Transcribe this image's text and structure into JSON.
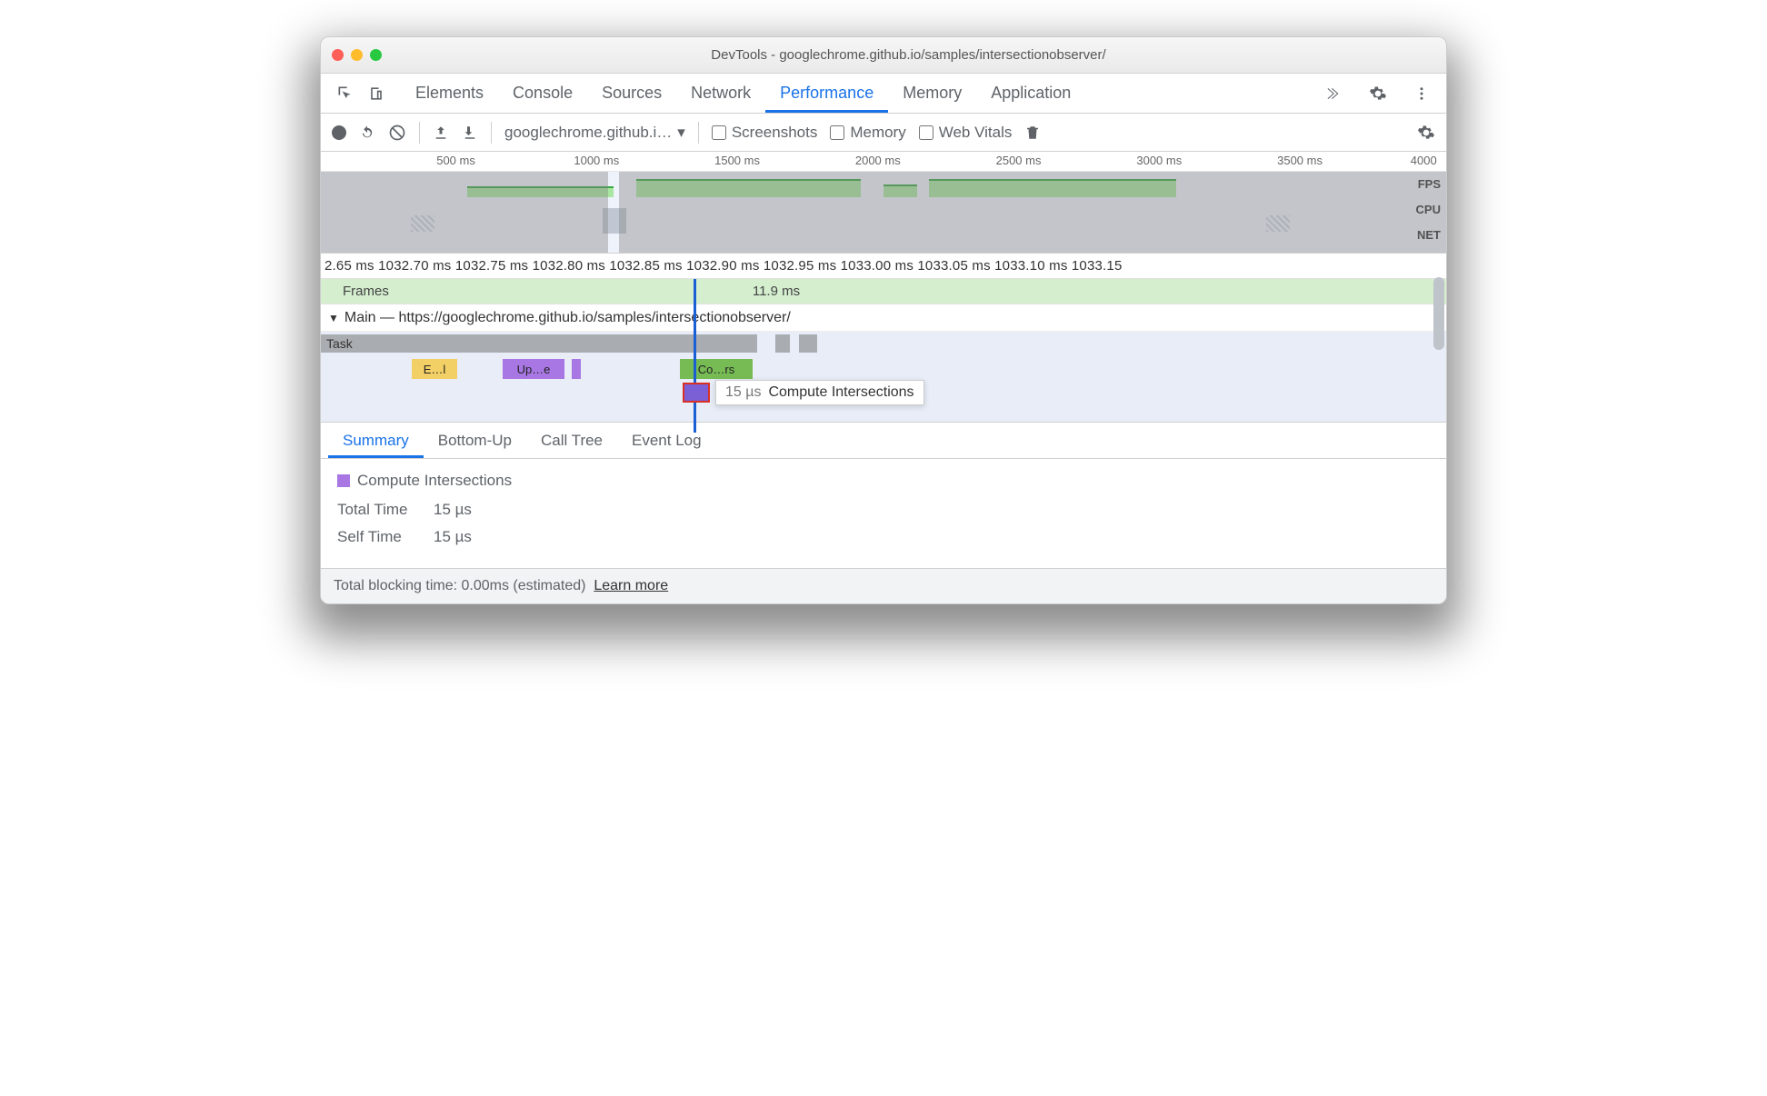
{
  "window": {
    "title": "DevTools - googlechrome.github.io/samples/intersectionobserver/"
  },
  "tabs": {
    "items": [
      "Elements",
      "Console",
      "Sources",
      "Network",
      "Performance",
      "Memory",
      "Application"
    ],
    "active": "Performance"
  },
  "toolbar": {
    "url": "googlechrome.github.i…",
    "screenshots": "Screenshots",
    "memory": "Memory",
    "webvitals": "Web Vitals"
  },
  "ruler": [
    "500 ms",
    "1000 ms",
    "1500 ms",
    "2000 ms",
    "2500 ms",
    "3000 ms",
    "3500 ms",
    "4000 ms"
  ],
  "overview_labels": [
    "FPS",
    "CPU",
    "NET"
  ],
  "zoom_ruler": "2.65 ms 1032.70 ms 1032.75 ms 1032.80 ms 1032.85 ms 1032.90 ms 1032.95 ms 1033.00 ms 1033.05 ms 1033.10 ms 1033.15",
  "frames": {
    "label": "Frames",
    "value": "11.9 ms"
  },
  "main_header": "Main — https://googlechrome.github.io/samples/intersectionobserver/",
  "flame": {
    "task": "Task",
    "yellow": "E…l",
    "purple": "Up…e",
    "green": "Co…rs",
    "tooltip_duration": "15 µs",
    "tooltip_label": "Compute Intersections"
  },
  "detail_tabs": [
    "Summary",
    "Bottom-Up",
    "Call Tree",
    "Event Log"
  ],
  "detail_active": "Summary",
  "summary": {
    "name": "Compute Intersections",
    "total_label": "Total Time",
    "total_value": "15 µs",
    "self_label": "Self Time",
    "self_value": "15 µs"
  },
  "footer": {
    "text": "Total blocking time: 0.00ms (estimated)",
    "link": "Learn more"
  }
}
